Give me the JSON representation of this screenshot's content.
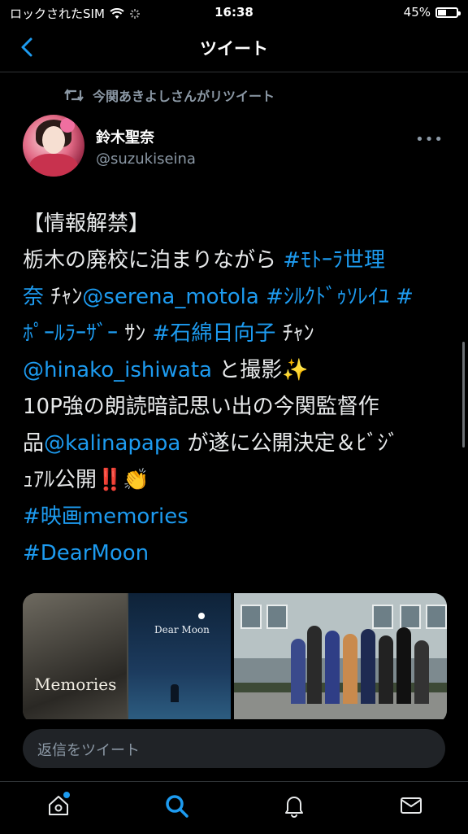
{
  "status_bar": {
    "carrier": "ロックされたSIM",
    "time": "16:38",
    "battery_percent_text": "45%",
    "battery_level": 0.45
  },
  "nav": {
    "title": "ツイート"
  },
  "tweet": {
    "retweet_text": "今関あきよしさんがリツイート",
    "author_name": "鈴木聖奈",
    "author_handle": "@suzukiseina",
    "more": "•••",
    "lines": [
      [
        {
          "t": "【情報解禁】"
        }
      ],
      [
        {
          "t": "栃木の廃校に泊まりながら "
        },
        {
          "t": "#ﾓﾄｰﾗ世理",
          "link": true
        }
      ],
      [
        {
          "t": "奈",
          "link": true
        },
        {
          "t": " ﾁｬﾝ"
        },
        {
          "t": "@serena_motola",
          "link": true
        },
        {
          "t": " "
        },
        {
          "t": "#ｼﾙｸﾄﾞｩｿﾚｲﾕ",
          "link": true
        },
        {
          "t": " "
        },
        {
          "t": "#",
          "link": true
        }
      ],
      [
        {
          "t": "ﾎﾟｰﾙﾗｰｻﾞｰ",
          "link": true
        },
        {
          "t": " ｻﾝ "
        },
        {
          "t": "#石綿日向子",
          "link": true
        },
        {
          "t": " ﾁｬﾝ"
        }
      ],
      [
        {
          "t": "@hinako_ishiwata",
          "link": true
        },
        {
          "t": " と撮影✨"
        }
      ],
      [
        {
          "t": "10P強の朗読暗記思い出の今関監督作"
        }
      ],
      [
        {
          "t": "品"
        },
        {
          "t": "@kalinapapa",
          "link": true
        },
        {
          "t": " が遂に公開決定＆ﾋﾞｼﾞ"
        }
      ],
      [
        {
          "t": "ｭｱﾙ公開‼️👏"
        }
      ],
      [
        {
          "t": "#映画memories",
          "link": true
        }
      ],
      [
        {
          "t": "#DearMoon",
          "link": true
        }
      ]
    ],
    "media": {
      "poster1_title": "Memories",
      "poster2_title": "Dear Moon"
    }
  },
  "compose": {
    "placeholder": "返信をツイート"
  },
  "tabs": [
    {
      "name": "home",
      "icon": "home-icon"
    },
    {
      "name": "search",
      "icon": "search-icon"
    },
    {
      "name": "notifications",
      "icon": "bell-icon"
    },
    {
      "name": "messages",
      "icon": "mail-icon"
    }
  ],
  "colors": {
    "background": "#000000",
    "link": "#1d9bf0",
    "muted": "#8b98a5"
  }
}
